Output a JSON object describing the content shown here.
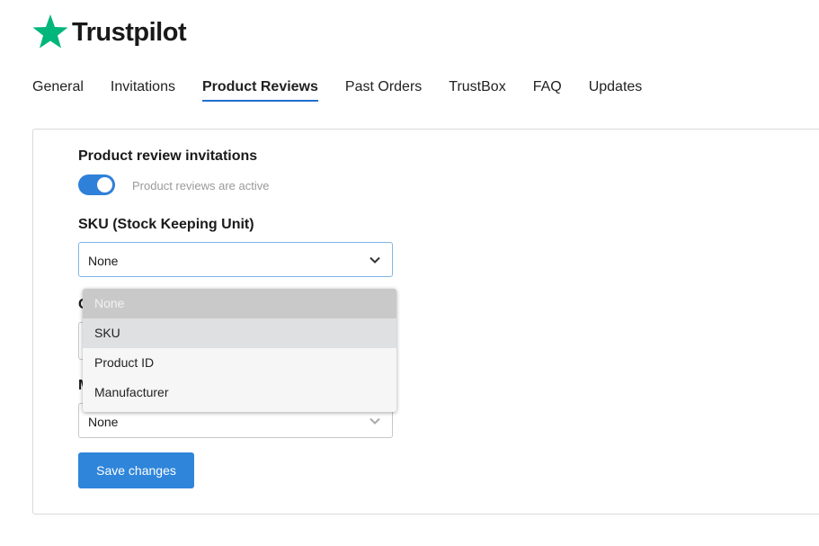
{
  "brand": {
    "name": "Trustpilot",
    "star_color": "#00b67a"
  },
  "tabs": [
    {
      "label": "General",
      "active": false
    },
    {
      "label": "Invitations",
      "active": false
    },
    {
      "label": "Product Reviews",
      "active": true
    },
    {
      "label": "Past Orders",
      "active": false
    },
    {
      "label": "TrustBox",
      "active": false
    },
    {
      "label": "FAQ",
      "active": false
    },
    {
      "label": "Updates",
      "active": false
    }
  ],
  "form": {
    "invitations_title": "Product review invitations",
    "toggle": {
      "on": true,
      "label": "Product reviews are active"
    },
    "sku": {
      "label": "SKU (Stock Keeping Unit)",
      "value": "None"
    },
    "gtin": {
      "label_visible_fragment": "G"
    },
    "mpn": {
      "label_visible_fragment": "M",
      "value": "None"
    },
    "dropdown_options": [
      "None",
      "SKU",
      "Product ID",
      "Manufacturer"
    ],
    "dropdown_selected": "None",
    "dropdown_hovered": "SKU",
    "save_label": "Save changes"
  },
  "colors": {
    "accent": "#2f85da",
    "tab_underline": "#1f6fd0"
  },
  "icons": {
    "logo": "star-icon",
    "select_arrow": "chevron-down-icon"
  }
}
